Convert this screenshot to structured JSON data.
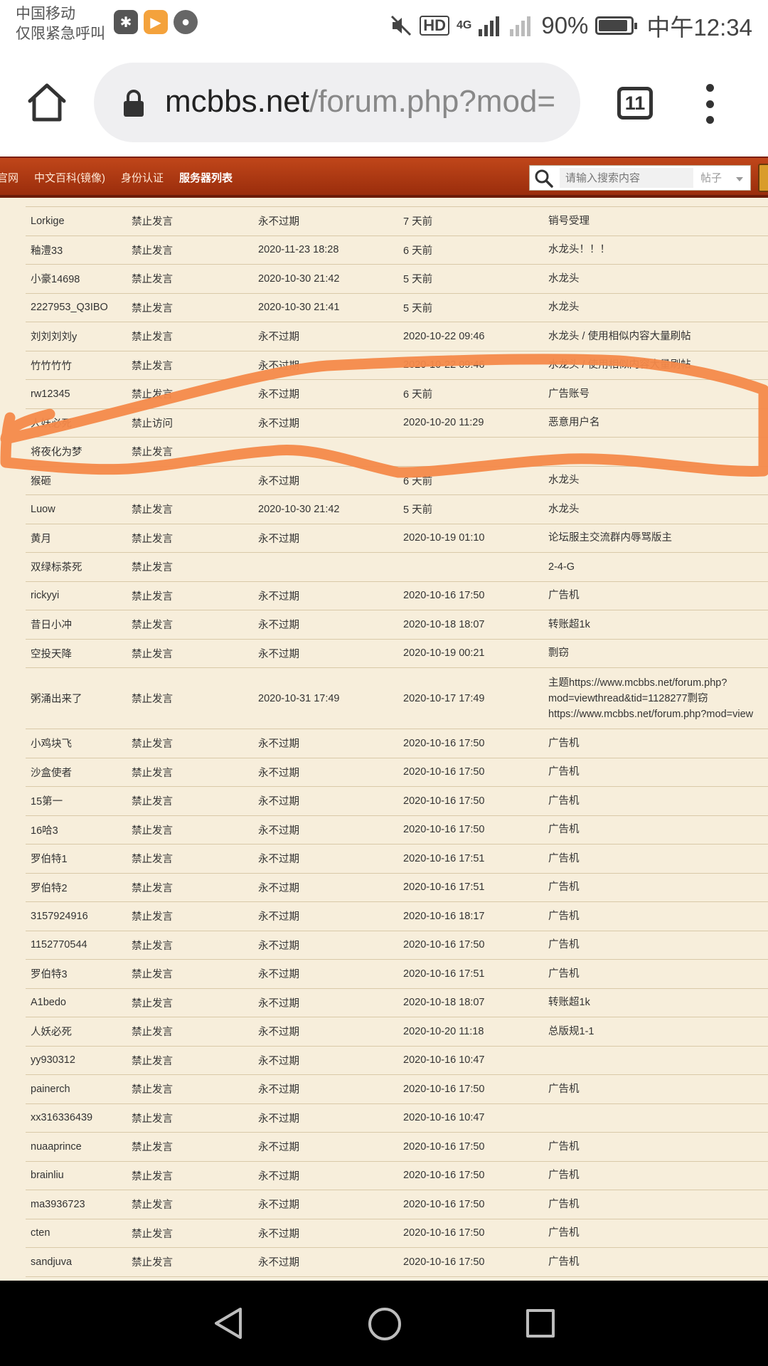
{
  "status_bar": {
    "carrier_line1": "中国移动",
    "carrier_line2": "仅限紧急呼叫",
    "notifications": [
      "star-icon",
      "play-icon",
      "chat-icon"
    ],
    "hd_label": "HD",
    "network_label": "4G",
    "battery_percent": "90%",
    "battery_level": 0.9,
    "time": "中午12:34"
  },
  "browser": {
    "url_host": "mcbbs.net",
    "url_path": "/forum.php?mod=",
    "tab_count": "11"
  },
  "site_nav": {
    "items": [
      "官网",
      "中文百科(镜像)",
      "身份认证",
      "服务器列表"
    ],
    "search_placeholder": "请输入搜索内容",
    "search_type": "帖子"
  },
  "ban_table": {
    "rows": [
      {
        "user": "Lorkige",
        "action": "禁止发言",
        "expires": "永不过期",
        "time": "7 天前",
        "reason": "销号受理"
      },
      {
        "user": "釉澧33",
        "action": "禁止发言",
        "expires": "2020-11-23 18:28",
        "time": "6 天前",
        "reason": "水龙头！！！"
      },
      {
        "user": "小豪14698",
        "action": "禁止发言",
        "expires": "2020-10-30 21:42",
        "time": "5 天前",
        "reason": "水龙头"
      },
      {
        "user": "2227953_Q3IBO",
        "action": "禁止发言",
        "expires": "2020-10-30 21:41",
        "time": "5 天前",
        "reason": "水龙头"
      },
      {
        "user": "刘刘刘刘y",
        "action": "禁止发言",
        "expires": "永不过期",
        "time": "2020-10-22 09:46",
        "reason": "水龙头 / 使用相似内容大量刷帖"
      },
      {
        "user": "竹竹竹竹",
        "action": "禁止发言",
        "expires": "永不过期",
        "time": "2020-10-22 09:46",
        "reason": "水龙头 / 使用相似内容大量刷帖"
      },
      {
        "user": "rw12345",
        "action": "禁止发言",
        "expires": "永不过期",
        "time": "6 天前",
        "reason": "广告账号"
      },
      {
        "user": "人妖必死",
        "action": "禁止访问",
        "expires": "永不过期",
        "time": "2020-10-20 11:29",
        "reason": "恶意用户名"
      },
      {
        "user": "将夜化为梦",
        "action": "禁止发言",
        "expires": "",
        "time": "",
        "reason": ""
      },
      {
        "user": "猴砸",
        "action": "",
        "expires": "永不过期",
        "time": "6 天前",
        "reason": "水龙头"
      },
      {
        "user": "Luow",
        "action": "禁止发言",
        "expires": "2020-10-30 21:42",
        "time": "5 天前",
        "reason": "水龙头"
      },
      {
        "user": "黄月",
        "action": "禁止发言",
        "expires": "永不过期",
        "time": "2020-10-19 01:10",
        "reason": "论坛服主交流群内辱骂版主"
      },
      {
        "user": "双绿标茶死",
        "action": "禁止发言",
        "expires": "",
        "time": "",
        "reason": "2-4-G"
      },
      {
        "user": "rickyyi",
        "action": "禁止发言",
        "expires": "永不过期",
        "time": "2020-10-16 17:50",
        "reason": "广告机"
      },
      {
        "user": "昔日小冲",
        "action": "禁止发言",
        "expires": "永不过期",
        "time": "2020-10-18 18:07",
        "reason": "转账超1k"
      },
      {
        "user": "空投天降",
        "action": "禁止发言",
        "expires": "永不过期",
        "time": "2020-10-19 00:21",
        "reason": "剽窃"
      },
      {
        "user": "粥涌出来了",
        "action": "禁止发言",
        "expires": "2020-10-31 17:49",
        "time": "2020-10-17 17:49",
        "reason": "主题https://www.mcbbs.net/forum.php?\nmod=viewthread&tid=1128277剽窃\nhttps://www.mcbbs.net/forum.php?mod=view"
      },
      {
        "user": "小鸡块飞",
        "action": "禁止发言",
        "expires": "永不过期",
        "time": "2020-10-16 17:50",
        "reason": "广告机"
      },
      {
        "user": "沙盒使者",
        "action": "禁止发言",
        "expires": "永不过期",
        "time": "2020-10-16 17:50",
        "reason": "广告机"
      },
      {
        "user": "15第一",
        "action": "禁止发言",
        "expires": "永不过期",
        "time": "2020-10-16 17:50",
        "reason": "广告机"
      },
      {
        "user": "16哈3",
        "action": "禁止发言",
        "expires": "永不过期",
        "time": "2020-10-16 17:50",
        "reason": "广告机"
      },
      {
        "user": "罗伯特1",
        "action": "禁止发言",
        "expires": "永不过期",
        "time": "2020-10-16 17:51",
        "reason": "广告机"
      },
      {
        "user": "罗伯特2",
        "action": "禁止发言",
        "expires": "永不过期",
        "time": "2020-10-16 17:51",
        "reason": "广告机"
      },
      {
        "user": "3157924916",
        "action": "禁止发言",
        "expires": "永不过期",
        "time": "2020-10-16 18:17",
        "reason": "广告机"
      },
      {
        "user": "1152770544",
        "action": "禁止发言",
        "expires": "永不过期",
        "time": "2020-10-16 17:50",
        "reason": "广告机"
      },
      {
        "user": "罗伯特3",
        "action": "禁止发言",
        "expires": "永不过期",
        "time": "2020-10-16 17:51",
        "reason": "广告机"
      },
      {
        "user": "A1bedo",
        "action": "禁止发言",
        "expires": "永不过期",
        "time": "2020-10-18 18:07",
        "reason": "转账超1k"
      },
      {
        "user": "人妖必死",
        "action": "禁止发言",
        "expires": "永不过期",
        "time": "2020-10-20 11:18",
        "reason": "总版规1-1"
      },
      {
        "user": "yy930312",
        "action": "禁止发言",
        "expires": "永不过期",
        "time": "2020-10-16 10:47",
        "reason": ""
      },
      {
        "user": "painerch",
        "action": "禁止发言",
        "expires": "永不过期",
        "time": "2020-10-16 17:50",
        "reason": "广告机"
      },
      {
        "user": "xx316336439",
        "action": "禁止发言",
        "expires": "永不过期",
        "time": "2020-10-16 10:47",
        "reason": ""
      },
      {
        "user": "nuaaprince",
        "action": "禁止发言",
        "expires": "永不过期",
        "time": "2020-10-16 17:50",
        "reason": "广告机"
      },
      {
        "user": "brainliu",
        "action": "禁止发言",
        "expires": "永不过期",
        "time": "2020-10-16 17:50",
        "reason": "广告机"
      },
      {
        "user": "ma3936723",
        "action": "禁止发言",
        "expires": "永不过期",
        "time": "2020-10-16 17:50",
        "reason": "广告机"
      },
      {
        "user": "cten",
        "action": "禁止发言",
        "expires": "永不过期",
        "time": "2020-10-16 17:50",
        "reason": "广告机"
      },
      {
        "user": "sandjuva",
        "action": "禁止发言",
        "expires": "永不过期",
        "time": "2020-10-16 17:50",
        "reason": "广告机"
      }
    ]
  },
  "colors": {
    "nav_red": "#b03a14",
    "page_bg": "#f7eedb",
    "annotation_orange": "#f4894a"
  }
}
